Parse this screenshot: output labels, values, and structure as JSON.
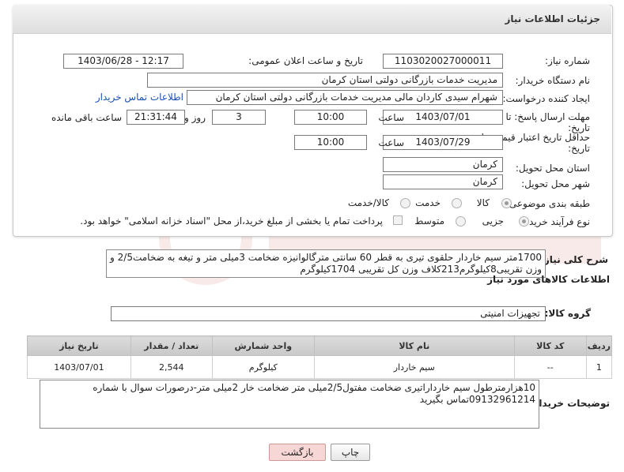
{
  "page": {
    "title": "جزئیات اطلاعات نیاز"
  },
  "fields": {
    "need_number_label": "شماره نیاز:",
    "need_number": "1103020027000011",
    "announce_label": "تاریخ و ساعت اعلان عمومی:",
    "announce_value": "1403/06/28 - 12:17",
    "buyer_org_label": "نام دستگاه خریدار:",
    "buyer_org": "مدیریت خدمات بازرگانی دولتی استان کرمان",
    "creator_label": "ایجاد کننده درخواست:",
    "creator": "شهرام سیدی کاردان مالی مدیریت خدمات بازرگانی دولتی استان کرمان",
    "contact_link": "اطلاعات تماس خریدار",
    "deadline_label_1": "مهلت ارسال پاسخ: تا",
    "deadline_label_2": "تاریخ:",
    "deadline_date": "1403/07/01",
    "time_label": "ساعت",
    "deadline_time": "10:00",
    "days_value": "3",
    "days_label": "روز و",
    "remaining_time": "21:31:44",
    "remaining_label": "ساعت باقی مانده",
    "validity_label_1": "حداقل تاریخ اعتبار قیمت: تا",
    "validity_label_2": "تاریخ:",
    "validity_date": "1403/07/29",
    "validity_time": "10:00",
    "province_label": "استان محل تحویل:",
    "province": "کرمان",
    "city_label": "شهر محل تحویل:",
    "city": "کرمان",
    "category_label": "طبقه بندی موضوعی:",
    "category_options": [
      "کالا",
      "خدمت",
      "کالا/خدمت"
    ],
    "process_label": "نوع فرآیند خرید :",
    "process_options": [
      "جزیی",
      "متوسط"
    ],
    "payment_note": "پرداخت تمام یا بخشی از مبلغ خرید،از محل \"اسناد خزانه اسلامی\" خواهد بود."
  },
  "description": {
    "label": "شرح کلی نیاز:",
    "line1": "1700متر سیم خاردار حلقوی تیری به قطر 60 سانتی مترگالوانیزه ضخامت 3میلی متر و تیغه به ضخامت2/5 و",
    "line2": "وزن تقریبی8کیلوگرم213کلاف وزن کل تقریبی 1704کیلوگرم"
  },
  "goods": {
    "section_title": "اطلاعات کالاهای مورد نیاز",
    "group_label": "گروه کالا:",
    "group_value": "تجهیزات امنیتی",
    "headers": [
      "ردیف",
      "کد کالا",
      "نام کالا",
      "واحد شمارش",
      "تعداد / مقدار",
      "تاریخ نیاز"
    ],
    "rows": [
      [
        "1",
        "--",
        "سیم خاردار",
        "کیلوگرم",
        "2,544",
        "1403/07/01"
      ]
    ]
  },
  "buyer_notes": {
    "label": "توضیحات خریدار:",
    "line1": "10هزارمترطول سیم خارداراتیری ضخامت مفتول2/5میلی متر ضخامت خار 2میلی متر-درصورات سوال با شماره",
    "line2": "09132961214تماس بگیرید"
  },
  "buttons": {
    "print": "چاپ",
    "back": "بازگشت"
  },
  "colors": {
    "back_button_bg": "#f7d6d6",
    "link": "#1a4fb5"
  }
}
